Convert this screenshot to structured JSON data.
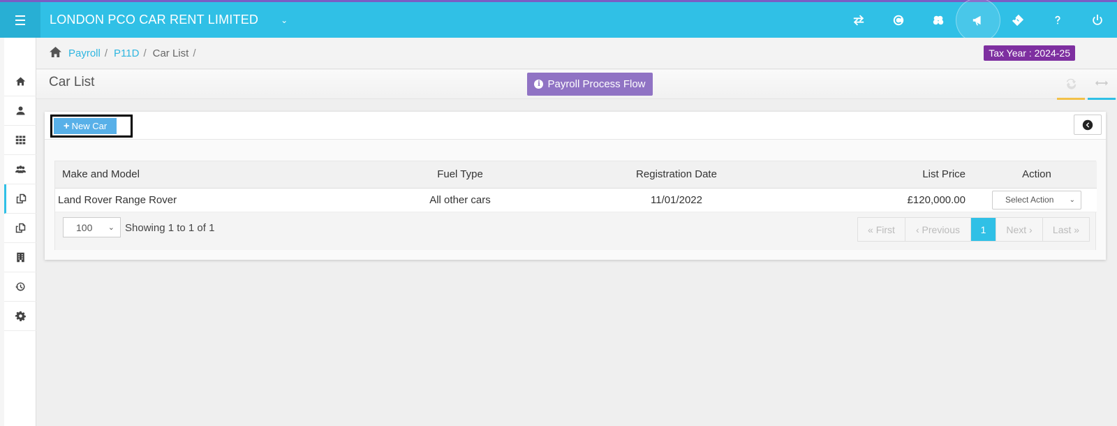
{
  "topbar": {
    "company": "LONDON PCO CAR RENT LIMITED",
    "icons": [
      "transfer-icon",
      "currency-icon",
      "coins-icon",
      "announcement-icon",
      "ticket-icon",
      "help-icon",
      "power-icon"
    ]
  },
  "sidebar": {
    "items": [
      "home-icon",
      "user-icon",
      "apps-grid-icon",
      "users-icon",
      "copy-icon",
      "copy-alt-icon",
      "building-icon",
      "history-icon",
      "settings-icon"
    ],
    "active_index": 4
  },
  "breadcrumb": {
    "items": [
      "Payroll",
      "P11D",
      "Car List"
    ],
    "separator": "/"
  },
  "tax_year": "Tax Year : 2024-25",
  "page": {
    "title": "Car List",
    "flow_button": "Payroll Process Flow"
  },
  "panel": {
    "new_car_label": "New Car"
  },
  "table": {
    "headers": {
      "make": "Make and Model",
      "fuel": "Fuel Type",
      "reg": "Registration Date",
      "price": "List Price",
      "action": "Action"
    },
    "rows": [
      {
        "make": "Land Rover Range Rover",
        "fuel": "All other cars",
        "reg": "11/01/2022",
        "price": "£120,000.00",
        "action": "Select Action"
      }
    ]
  },
  "footer": {
    "page_size": "100",
    "showing": "Showing 1 to 1 of 1",
    "pager": {
      "first": "« First",
      "previous": "‹ Previous",
      "current": "1",
      "next": "Next ›",
      "last": "Last »"
    }
  },
  "colors": {
    "topbar": "#30c0e6",
    "tax_year_badge": "#7e2fa0",
    "flow_button": "#9073c4",
    "new_car_button": "#58b0e8",
    "active_page": "#30c0e6"
  }
}
